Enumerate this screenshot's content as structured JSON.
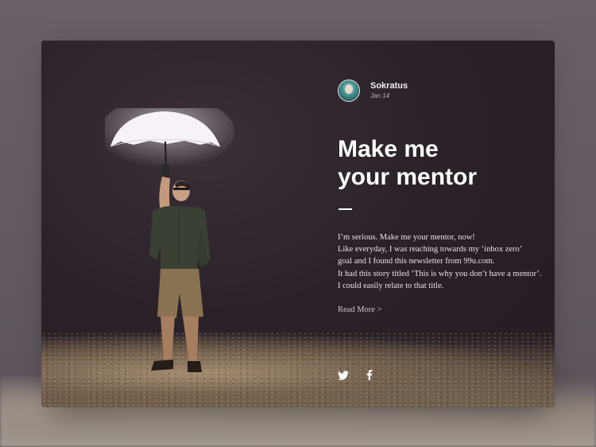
{
  "author": {
    "name": "Sokratus",
    "date": "Jan 14"
  },
  "post": {
    "title_line1": "Make me",
    "title_line2": "your mentor",
    "body_lines": [
      "I’m serious. Make me your mentor, now!",
      "Like everyday, I was reaching towards my ‘inbox zero’",
      "goal and I found this newsletter from 99u.com.",
      "It had this story titled ‘This is why you don’t have a mentor’.",
      "I could easily relate to that title."
    ],
    "read_more": "Read More  >"
  },
  "social": {
    "icons": [
      "twitter-icon",
      "facebook-icon"
    ]
  },
  "colors": {
    "card_background": "#2b2229",
    "title": "#ffffff",
    "body_text": "#e7e1e5",
    "muted": "#b8aeb6"
  }
}
